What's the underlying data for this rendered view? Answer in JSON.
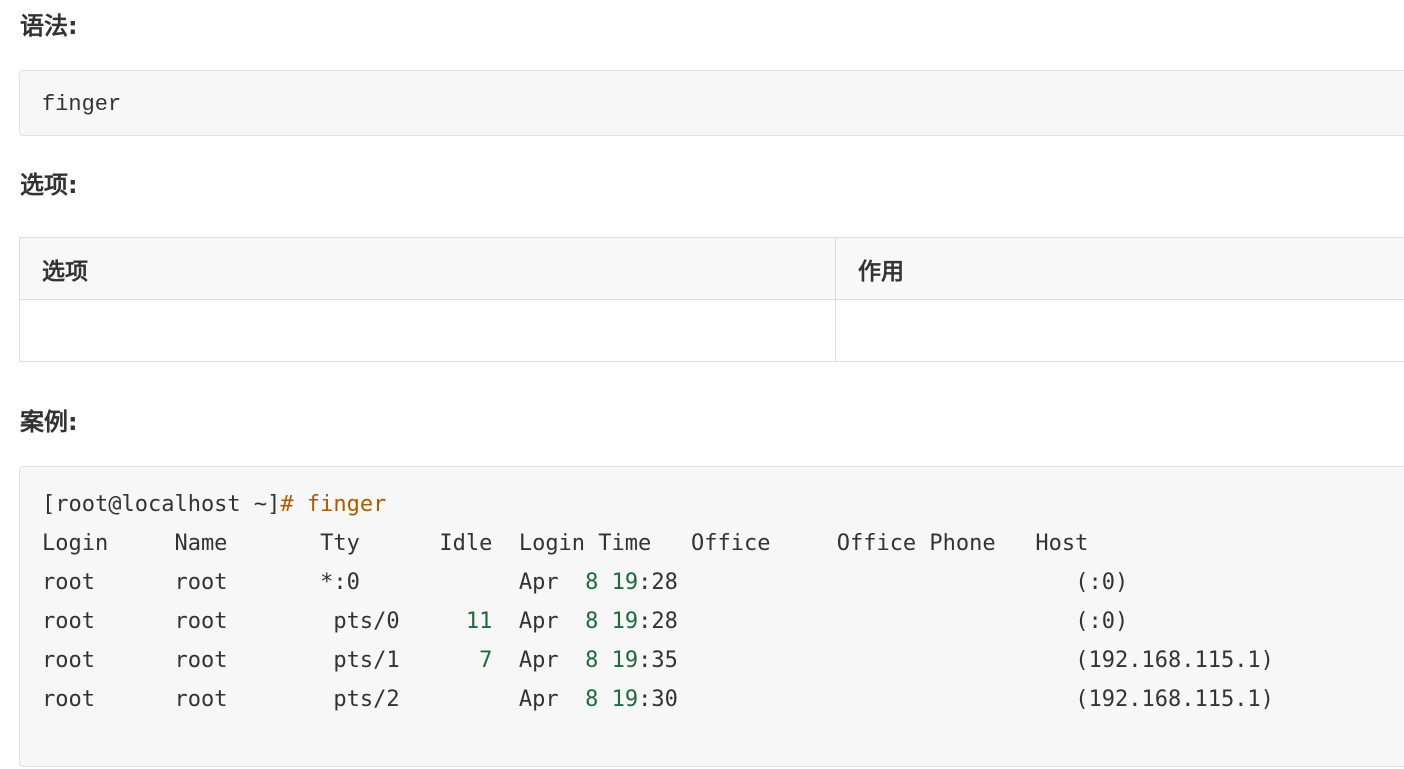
{
  "headings": {
    "syntax": "语法:",
    "options": "选项:",
    "example": "案例:"
  },
  "syntax_code": "finger",
  "options_table": {
    "headers": [
      "选项",
      "作用"
    ],
    "rows": [
      [
        "",
        ""
      ]
    ]
  },
  "example": {
    "prompt": "[root@localhost ~]",
    "command_hash": "# finger",
    "header_line": "Login     Name       Tty      Idle  Login Time   Office     Office Phone   Host",
    "rows": [
      {
        "login": "root",
        "name": "root",
        "tty": "*:0",
        "idle": "",
        "month": "Apr",
        "day": "8",
        "hour": "19",
        "min": ":28",
        "host": "(:0)"
      },
      {
        "login": "root",
        "name": "root",
        "tty": " pts/0",
        "idle": "11",
        "month": "Apr",
        "day": "8",
        "hour": "19",
        "min": ":28",
        "host": "(:0)"
      },
      {
        "login": "root",
        "name": "root",
        "tty": " pts/1",
        "idle": "7",
        "month": "Apr",
        "day": "8",
        "hour": "19",
        "min": ":35",
        "host": "(192.168.115.1)"
      },
      {
        "login": "root",
        "name": "root",
        "tty": " pts/2",
        "idle": "",
        "month": "Apr",
        "day": "8",
        "hour": "19",
        "min": ":30",
        "host": "(192.168.115.1)"
      }
    ]
  }
}
